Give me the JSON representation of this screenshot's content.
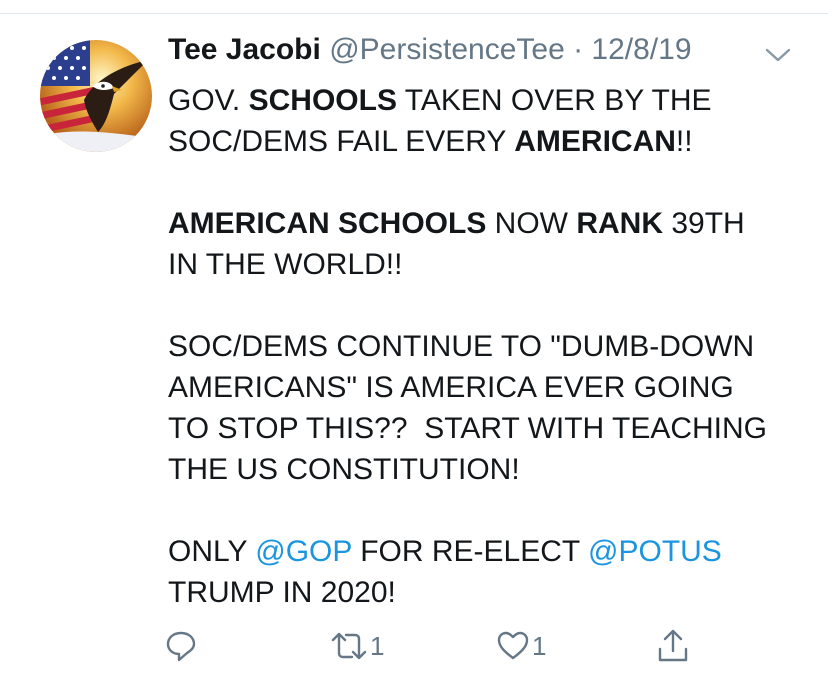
{
  "tweet": {
    "display_name": "Tee Jacobi",
    "handle": "@PersistenceTee",
    "separator": " · ",
    "date": "12/8/19",
    "body_lines": [
      [
        {
          "t": "GOV. "
        },
        {
          "t": "SCHOOLS",
          "b": true
        },
        {
          "t": " TAKEN OVER BY THE"
        }
      ],
      [
        {
          "t": "SOC/DEMS FAIL EVERY "
        },
        {
          "t": "AMERICAN",
          "b": true
        },
        {
          "t": "!!"
        }
      ],
      [],
      [
        {
          "t": "AMERICAN SCHOOLS",
          "b": true
        },
        {
          "t": " NOW "
        },
        {
          "t": "RANK",
          "b": true
        },
        {
          "t": " 39TH"
        }
      ],
      [
        {
          "t": "IN THE WORLD!!"
        }
      ],
      [],
      [
        {
          "t": "SOC/DEMS CONTINUE TO \"DUMB-DOWN"
        }
      ],
      [
        {
          "t": "AMERICANS\" IS AMERICA EVER GOING"
        }
      ],
      [
        {
          "t": "TO STOP THIS??  START WITH TEACHING"
        }
      ],
      [
        {
          "t": "THE US CONSTITUTION!"
        }
      ],
      [],
      [
        {
          "t": "ONLY "
        },
        {
          "t": "@GOP",
          "m": true
        },
        {
          "t": " FOR RE-ELECT "
        },
        {
          "t": "@POTUS",
          "m": true
        }
      ],
      [
        {
          "t": "TRUMP IN 2020!"
        }
      ]
    ],
    "retweet_count": "1",
    "like_count": "1"
  },
  "icons": {
    "avatar": "eagle-flag-avatar",
    "menu": "chevron-down-icon",
    "reply": "reply-icon",
    "retweet": "retweet-icon",
    "like": "heart-icon",
    "share": "share-icon"
  },
  "colors": {
    "text": "#14171a",
    "secondary": "#657786",
    "link": "#1b95e0",
    "divider": "#e1e8ed"
  }
}
